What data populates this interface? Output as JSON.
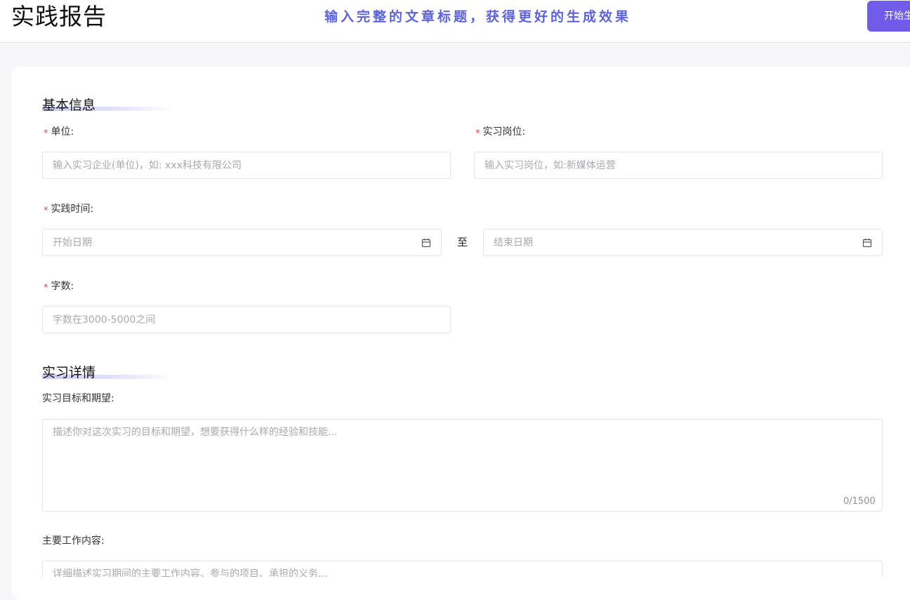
{
  "header": {
    "title": "实践报告",
    "tagline": "输入完整的文章标题，获得更好的生成效果",
    "start_button": "开始生成"
  },
  "basic": {
    "section_title": "基本信息",
    "unit": {
      "label": "单位:",
      "placeholder": "输入实习企业(单位)，如: xxx科技有限公司"
    },
    "position": {
      "label": "实习岗位:",
      "placeholder": "输入实习岗位，如:新媒体运营"
    },
    "time": {
      "label": "实践时间:",
      "start_placeholder": "开始日期",
      "separator": "至",
      "end_placeholder": "结束日期"
    },
    "words": {
      "label": "字数:",
      "placeholder": "字数在3000-5000之间"
    },
    "required_mark": "*"
  },
  "details": {
    "section_title": "实习详情",
    "goals": {
      "label": "实习目标和期望:",
      "placeholder": "描述你对这次实习的目标和期望，想要获得什么样的经验和技能...",
      "counter": "0/1500"
    },
    "work": {
      "label": "主要工作内容:",
      "placeholder": "详细描述实习期间的主要工作内容、参与的项目、承担的义务..."
    }
  },
  "icons": {
    "calendar": "calendar-icon"
  }
}
